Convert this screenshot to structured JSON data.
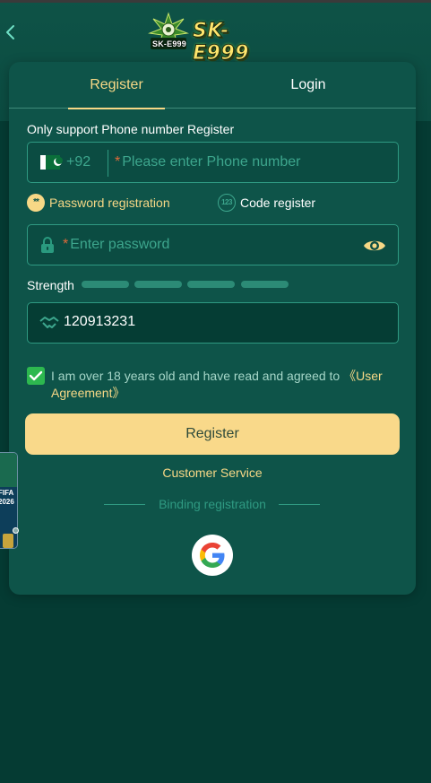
{
  "header": {
    "logo_small_text": "SK-E999",
    "logo_text": "SK-E999"
  },
  "tabs": [
    {
      "label": "Register",
      "active": true
    },
    {
      "label": "Login",
      "active": false
    }
  ],
  "form": {
    "note": "Only support Phone number Register",
    "phone": {
      "country_code": "+92",
      "required_mark": "*",
      "placeholder": "Please enter Phone number"
    },
    "options": [
      {
        "label": "Password registration",
        "icon_text": "**",
        "selected": true
      },
      {
        "label": "Code register",
        "icon_text": "123",
        "selected": false
      }
    ],
    "password": {
      "required_mark": "*",
      "placeholder": "Enter password"
    },
    "strength_label": "Strength",
    "invite_code": "120913231",
    "agreement": {
      "checked": true,
      "text": "I am over 18 years old and have read and agreed to ",
      "link": "《User Agreement》"
    },
    "register_button": "Register",
    "customer_service": "Customer Service",
    "binding_label": "Binding registration"
  },
  "side_banner": {
    "text": "FIFA 2026"
  },
  "colors": {
    "accent": "#f7d886",
    "card": "#0e5449",
    "border": "#2f9a82",
    "checkbox": "#2db84f"
  }
}
